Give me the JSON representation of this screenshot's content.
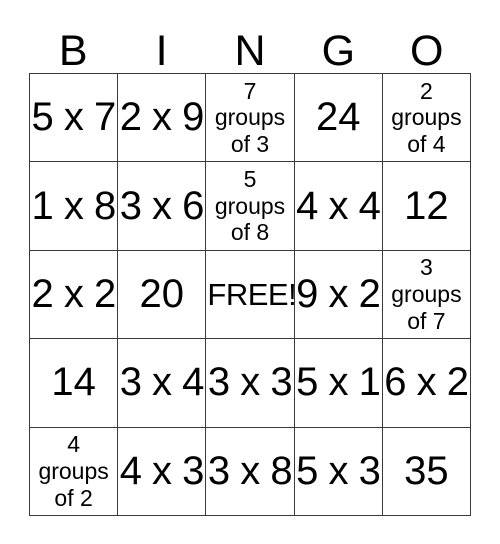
{
  "card": {
    "headers": [
      "B",
      "I",
      "N",
      "G",
      "O"
    ],
    "rows": [
      [
        {
          "text": "5 x 7",
          "kind": "expr"
        },
        {
          "text": "2 x 9",
          "kind": "expr"
        },
        {
          "text": "7\ngroups\nof 3",
          "kind": "groups"
        },
        {
          "text": "24",
          "kind": "num"
        },
        {
          "text": "2\ngroups\nof 4",
          "kind": "groups"
        }
      ],
      [
        {
          "text": "1 x 8",
          "kind": "expr"
        },
        {
          "text": "3 x 6",
          "kind": "expr"
        },
        {
          "text": "5\ngroups\nof 8",
          "kind": "groups"
        },
        {
          "text": "4 x 4",
          "kind": "expr"
        },
        {
          "text": "12",
          "kind": "num"
        }
      ],
      [
        {
          "text": "2 x 2",
          "kind": "expr"
        },
        {
          "text": "20",
          "kind": "num"
        },
        {
          "text": "FREE!",
          "kind": "free"
        },
        {
          "text": "9 x 2",
          "kind": "expr"
        },
        {
          "text": "3\ngroups\nof 7",
          "kind": "groups"
        }
      ],
      [
        {
          "text": "14",
          "kind": "num"
        },
        {
          "text": "3 x 4",
          "kind": "expr"
        },
        {
          "text": "3 x 3",
          "kind": "expr"
        },
        {
          "text": "5 x 1",
          "kind": "expr"
        },
        {
          "text": "6 x 2",
          "kind": "expr"
        }
      ],
      [
        {
          "text": "4\ngroups\nof 2",
          "kind": "groups"
        },
        {
          "text": "4 x 3",
          "kind": "expr"
        },
        {
          "text": "3 x 8",
          "kind": "expr"
        },
        {
          "text": "5 x 3",
          "kind": "expr"
        },
        {
          "text": "35",
          "kind": "num"
        }
      ]
    ],
    "colors": {
      "border": "#3a3a3a",
      "text": "#000000",
      "cell_background": "#ffffff",
      "page_background": "#ffffff"
    }
  }
}
